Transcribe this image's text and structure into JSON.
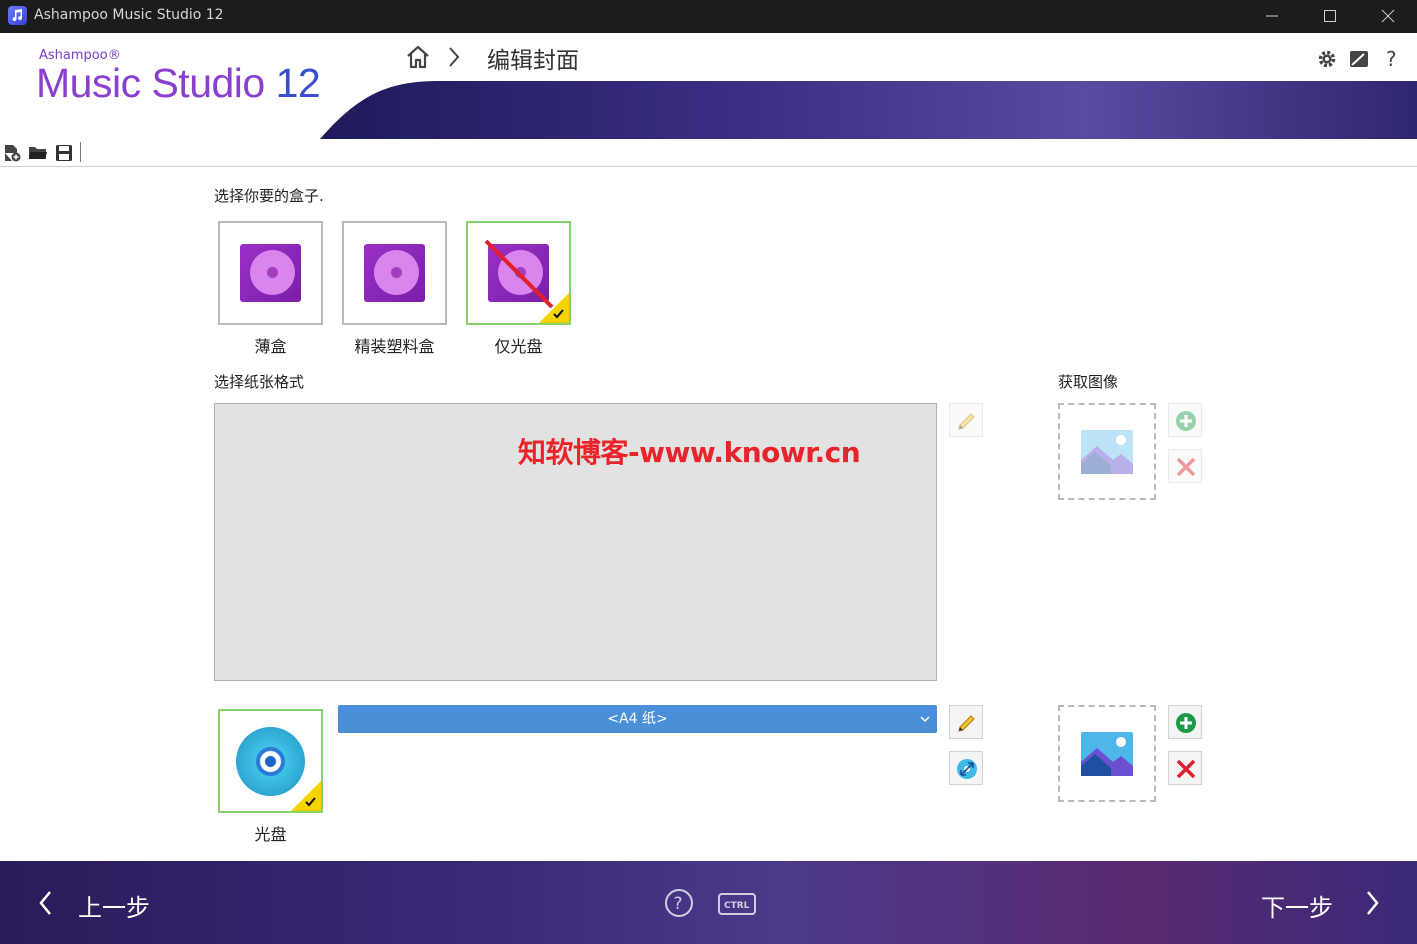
{
  "window": {
    "title": "Ashampoo Music Studio 12"
  },
  "logo": {
    "brand": "Ashampoo®",
    "product": "Music Studio",
    "version": "12"
  },
  "breadcrumb": {
    "title": "编辑封面"
  },
  "box_section": {
    "prompt": "选择你要的盒子.",
    "options": [
      {
        "label": "薄盒",
        "selected": false
      },
      {
        "label": "精装塑料盒",
        "selected": false
      },
      {
        "label": "仅光盘",
        "selected": true
      }
    ]
  },
  "paper_section": {
    "label": "选择纸张格式"
  },
  "image_section": {
    "label": "获取图像"
  },
  "watermark": "知软博客-www.knowr.cn",
  "disc_item": {
    "label": "光盘",
    "selected": true
  },
  "paper_format": {
    "value": "<A4 纸>"
  },
  "footer": {
    "back_label": "上一步",
    "next_label": "下一步",
    "ctrl_label": "CTRL"
  },
  "colors": {
    "accent": "#4a8fd8",
    "brand": "#8b3fd0",
    "check": "#f5d400",
    "selected_border": "#8bd16a"
  }
}
